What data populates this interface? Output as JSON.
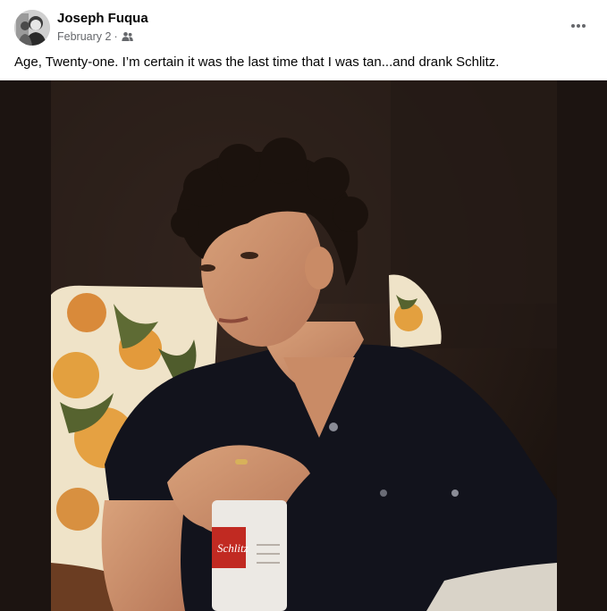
{
  "post": {
    "author": {
      "name": "Joseph Fuqua"
    },
    "date": "February 2",
    "separator": "·",
    "audience_icon": "friends-icon",
    "more_icon": "more-options-icon",
    "caption": "Age, Twenty-one. I’m certain it was the last time that I was tan...and drank Schlitz.",
    "photo": {
      "can_label": "Schlitz"
    }
  },
  "colors": {
    "name": "#050505",
    "meta": "#65676b",
    "photo_background": "#1c1411"
  }
}
